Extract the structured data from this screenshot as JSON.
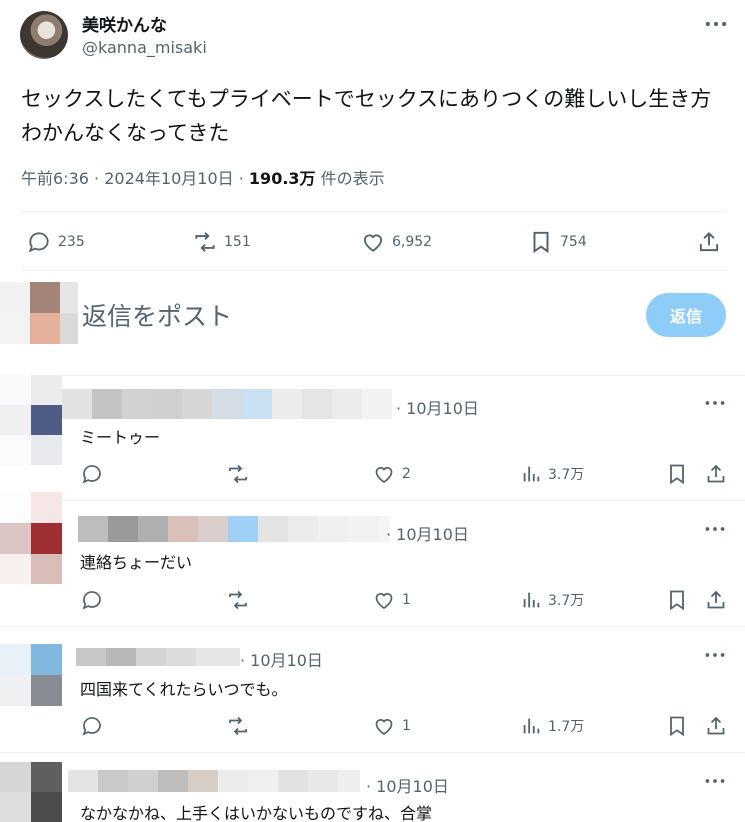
{
  "tweet": {
    "author_name": "美咲かんな",
    "author_handle": "@kanna_misaki",
    "text_line1": "セックスしたくてもプライベートでセックスにありつくの難しいし生き方",
    "text_line2": "わかんなくなってきた",
    "time": "午前6:36",
    "date": "2024年10月10日",
    "views": "190.3万",
    "views_label": "件の表示",
    "replies": "235",
    "reposts": "151",
    "likes": "6,952",
    "bookmarks": "754"
  },
  "reply_box": {
    "placeholder": "返信をポスト",
    "button_label": "返信"
  },
  "replies": [
    {
      "date": "10月10日",
      "text": "ミートゥー",
      "likes": "2",
      "views": "3.7万"
    },
    {
      "date": "10月10日",
      "text": "連絡ちょーだい",
      "likes": "1",
      "views": "3.7万"
    },
    {
      "date": "10月10日",
      "text": "四国来てくれたらいつでも。",
      "likes": "1",
      "views": "1.7万"
    },
    {
      "date": "10月10日",
      "text": "なかなかね、上手くはいかないものですね、合掌"
    }
  ],
  "colors": {
    "text": "#0f1419",
    "muted": "#536471",
    "reply_button": "#8ecdf8",
    "divider": "#eff3f4"
  },
  "icons": [
    "more-icon",
    "comment-icon",
    "repost-icon",
    "heart-icon",
    "bookmark-icon",
    "share-icon",
    "views-icon"
  ]
}
